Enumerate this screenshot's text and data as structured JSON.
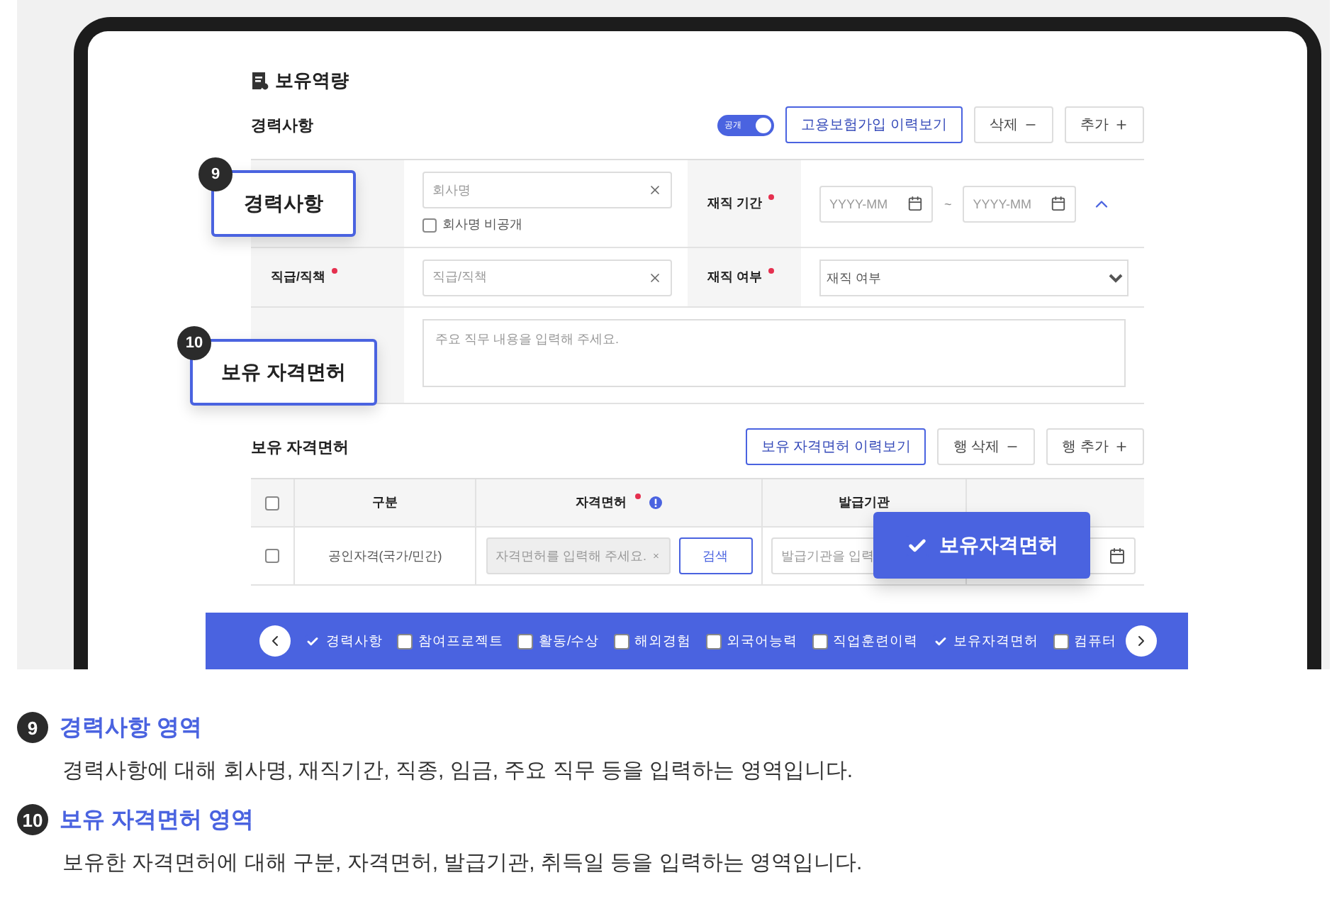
{
  "section_title": "보유역량",
  "career": {
    "title": "경력사항",
    "public_toggle": {
      "label": "공개",
      "on": true
    },
    "history_button": "고용보험가입 이력보기",
    "delete_button": "삭제",
    "add_button": "추가",
    "company": {
      "placeholder": "회사명",
      "private": {
        "label": "회사명 비공개",
        "checked": false
      }
    },
    "period": {
      "label": "재직 기간",
      "from_placeholder": "YYYY-MM",
      "separator": "~",
      "to_placeholder": "YYYY-MM",
      "expanded": true
    },
    "position": {
      "label": "직급/직책",
      "placeholder": "직급/직책"
    },
    "employed": {
      "label": "재직 여부",
      "value": "재직 여부"
    },
    "duties": {
      "placeholder": "주요 직무 내용을 입력해 주세요."
    }
  },
  "licenses": {
    "title": "보유 자격면허",
    "history_button": "보유 자격면허 이력보기",
    "delete_button": "행 삭제",
    "add_button": "행 추가",
    "columns": [
      {
        "label": "구분",
        "required": false,
        "info": false
      },
      {
        "label": "자격면허",
        "required": true,
        "info": true
      },
      {
        "label": "발급기관",
        "required": false,
        "info": false
      }
    ],
    "header_checked": false,
    "rows": [
      {
        "checked": false,
        "category": "공인자격(국가/민간)",
        "license_placeholder": "자격면허를 입력해 주세요.",
        "search_button": "검색",
        "issuer_placeholder": "발급기관을 입력"
      }
    ]
  },
  "nav_bar": {
    "items": [
      {
        "label": "경력사항",
        "checked": true
      },
      {
        "label": "참여프로젝트",
        "checked": false
      },
      {
        "label": "활동/수상",
        "checked": false
      },
      {
        "label": "해외경험",
        "checked": false
      },
      {
        "label": "외국어능력",
        "checked": false
      },
      {
        "label": "직업훈련이력",
        "checked": false
      },
      {
        "label": "보유자격면허",
        "checked": true
      },
      {
        "label": "컴퓨터",
        "checked": false
      }
    ]
  },
  "callouts": [
    {
      "number": "9",
      "label": "경력사항"
    },
    {
      "number": "10",
      "label": "보유 자격면허"
    }
  ],
  "check_callout": {
    "label": "보유자격면허",
    "checked": true
  },
  "descriptions": [
    {
      "number": "9",
      "title": "경력사항 영역",
      "text": "경력사항에 대해 회사명, 재직기간, 직종, 임금, 주요 직무 등을 입력하는 영역입니다."
    },
    {
      "number": "10",
      "title": "보유 자격면허 영역",
      "text": "보유한 자격면허에 대해 구분, 자격면허, 발급기관, 취득일 등을 입력하는 영역입니다."
    }
  ]
}
